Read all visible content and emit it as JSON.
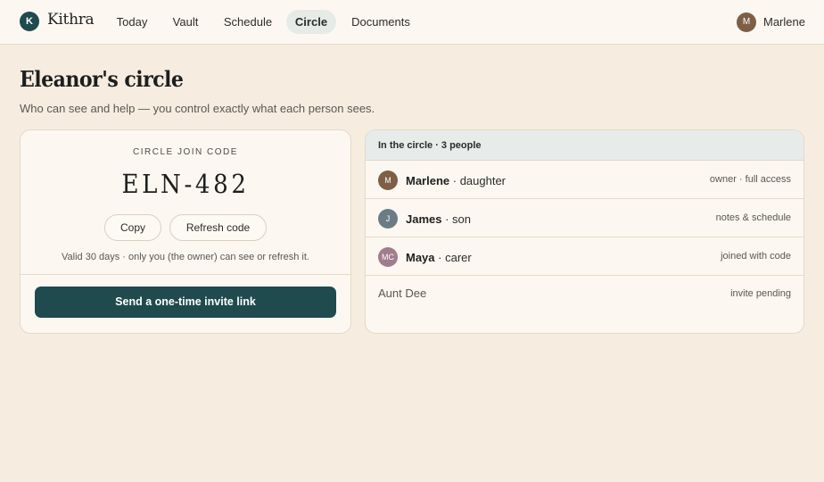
{
  "app": {
    "logo_initial": "K",
    "name": "Kithra"
  },
  "nav": {
    "items": [
      {
        "label": "Today"
      },
      {
        "label": "Vault"
      },
      {
        "label": "Schedule"
      },
      {
        "label": "Circle",
        "active": true
      },
      {
        "label": "Documents"
      }
    ]
  },
  "user": {
    "initial": "M",
    "name": "Marlene"
  },
  "page": {
    "title": "Eleanor's circle",
    "subtitle": "Who can see and help — you control exactly what each person sees."
  },
  "join_code": {
    "label": "CIRCLE JOIN CODE",
    "code": "ELN-482",
    "copy_label": "Copy",
    "refresh_label": "Refresh code",
    "note": "Valid 30 days · only you (the owner) can see or refresh it.",
    "invite_label": "Send a one-time invite link"
  },
  "circle": {
    "header": "In the circle · 3 people",
    "members": [
      {
        "initials": "M",
        "name": "Marlene",
        "role": " · daughter",
        "access": "owner · full access",
        "color": "#7d5f47"
      },
      {
        "initials": "J",
        "name": "James",
        "role": " · son",
        "access": "notes & schedule",
        "color": "#6b7c86"
      },
      {
        "initials": "MC",
        "name": "Maya",
        "role": " · carer",
        "access": "joined with code",
        "color": "#a07d8c"
      }
    ],
    "pending": {
      "name": "Aunt Dee",
      "status": "invite pending"
    }
  },
  "colors": {
    "accent": "#1f4a4e",
    "background": "#f6ede0",
    "card": "#fcf8f1"
  }
}
